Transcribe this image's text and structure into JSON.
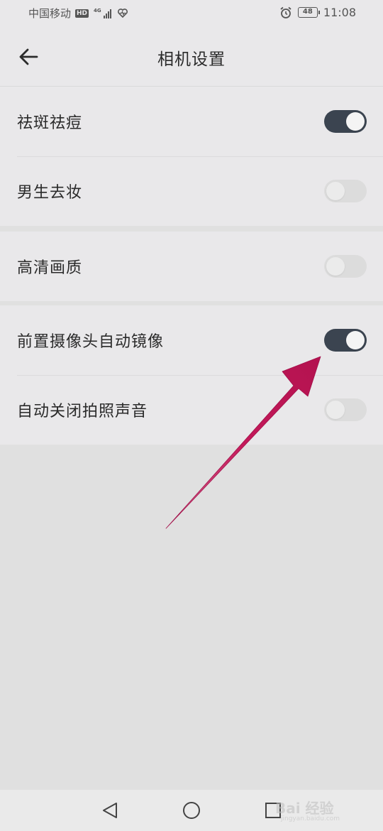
{
  "status_bar": {
    "carrier": "中国移动",
    "hd_badge": "HD",
    "network": "4G",
    "battery": "48",
    "time": "11:08",
    "icons": [
      "signal-icon",
      "heart-icon",
      "alarm-icon",
      "battery-icon"
    ]
  },
  "header": {
    "title": "相机设置",
    "back_icon": "back-arrow-icon"
  },
  "groups": [
    {
      "rows": [
        {
          "label": "祛斑祛痘",
          "toggle_on": true
        },
        {
          "label": "男生去妆",
          "toggle_on": false
        }
      ]
    },
    {
      "rows": [
        {
          "label": "高清画质",
          "toggle_on": false
        }
      ]
    },
    {
      "rows": [
        {
          "label": "前置摄像头自动镜像",
          "toggle_on": true
        },
        {
          "label": "自动关闭拍照声音",
          "toggle_on": false
        }
      ]
    }
  ],
  "nav_bar": {
    "buttons": [
      "back-triangle-icon",
      "home-circle-icon",
      "recents-square-icon"
    ]
  },
  "watermark": {
    "text": "Bai 经验",
    "sub": "jingyan.baidu.com"
  },
  "colors": {
    "toggle_on": "#3b4450",
    "toggle_off": "#dcdcdc",
    "annotation_arrow": "#c4195a",
    "background": "#e0e0e0",
    "surface": "#e9e8ea"
  }
}
